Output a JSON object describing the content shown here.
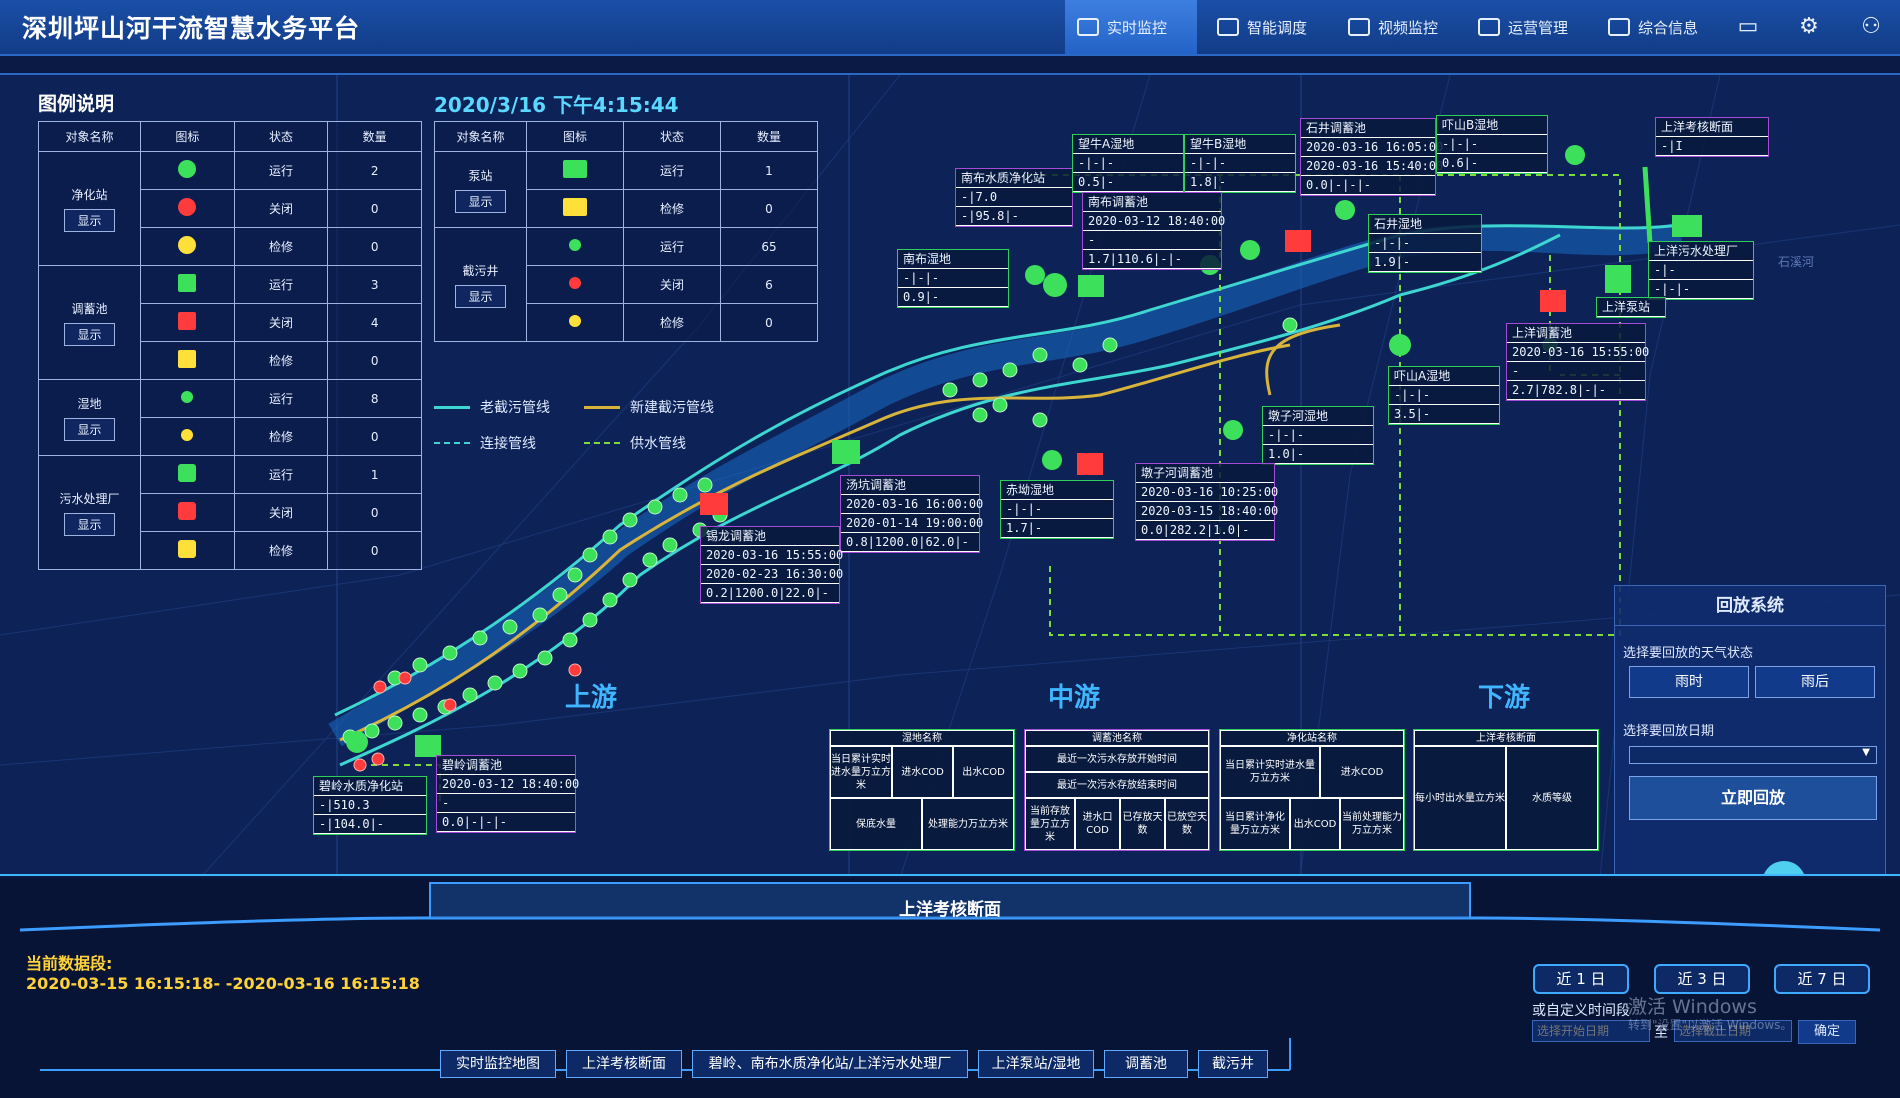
{
  "app": {
    "title": "深圳坪山河干流智慧水务平台"
  },
  "nav": [
    {
      "label": "实时监控",
      "active": true
    },
    {
      "label": "智能调度"
    },
    {
      "label": "视频监控"
    },
    {
      "label": "运营管理"
    },
    {
      "label": "综合信息"
    }
  ],
  "toolbar_icons": [
    "screen-icon",
    "settings-icon",
    "user-icon"
  ],
  "legend": {
    "title": "图例说明",
    "timestamp": "2020/3/16 下午4:15:44",
    "headers": [
      "对象名称",
      "图标",
      "状态",
      "数量"
    ],
    "show_label": "显示",
    "left": [
      {
        "name": "净化站",
        "rows": [
          {
            "status": "运行",
            "count": "2"
          },
          {
            "status": "关闭",
            "count": "0"
          },
          {
            "status": "检修",
            "count": "0"
          }
        ]
      },
      {
        "name": "调蓄池",
        "rows": [
          {
            "status": "运行",
            "count": "3"
          },
          {
            "status": "关闭",
            "count": "4"
          },
          {
            "status": "检修",
            "count": "0"
          }
        ]
      },
      {
        "name": "湿地",
        "rows": [
          {
            "status": "运行",
            "count": "8"
          },
          {
            "status": "检修",
            "count": "0"
          }
        ]
      },
      {
        "name": "污水处理厂",
        "rows": [
          {
            "status": "运行",
            "count": "1"
          },
          {
            "status": "关闭",
            "count": "0"
          },
          {
            "status": "检修",
            "count": "0"
          }
        ]
      }
    ],
    "right": [
      {
        "name": "泵站",
        "rows": [
          {
            "status": "运行",
            "count": "1"
          },
          {
            "status": "检修",
            "count": "0"
          }
        ]
      },
      {
        "name": "截污井",
        "rows": [
          {
            "status": "运行",
            "count": "65"
          },
          {
            "status": "关闭",
            "count": "6"
          },
          {
            "status": "检修",
            "count": "0"
          }
        ]
      }
    ],
    "lines": [
      {
        "label": "老截污管线",
        "color": "#3dd6d0",
        "style": "solid"
      },
      {
        "label": "新建截污管线",
        "color": "#d8b43a",
        "style": "solid"
      },
      {
        "label": "连接管线",
        "color": "#3dd6d0",
        "style": "dashed"
      },
      {
        "label": "供水管线",
        "color": "#7ddc3a",
        "style": "dashed"
      }
    ],
    "status_colors": {
      "运行": "#3ce05a",
      "关闭": "#ff3b3b",
      "检修": "#ffe03a"
    }
  },
  "map": {
    "regions": [
      "上游",
      "中游",
      "下游"
    ],
    "sites": [
      {
        "name": "南布水质净化站",
        "lines": [
          "-|7.0",
          "-|95.8|-"
        ],
        "kind": "p"
      },
      {
        "name": "望牛A湿地",
        "lines": [
          "-|-|-",
          "0.5|-"
        ],
        "kind": "g"
      },
      {
        "name": "望牛B湿地",
        "lines": [
          "-|-|-",
          "1.8|-"
        ],
        "kind": "g"
      },
      {
        "name": "石井调蓄池",
        "lines": [
          "2020-03-16 16:05:00",
          "2020-03-16 15:40:00",
          "0.0|-|-|-"
        ],
        "kind": "p"
      },
      {
        "name": "吓山B湿地",
        "lines": [
          "-|-|-",
          "0.6|-"
        ],
        "kind": "g"
      },
      {
        "name": "上洋考核断面",
        "lines": [
          "-|I"
        ],
        "kind": "p"
      },
      {
        "name": "南布调蓄池",
        "lines": [
          "2020-03-12 18:40:00",
          "-",
          "1.7|110.6|-|-"
        ],
        "kind": "p"
      },
      {
        "name": "南布湿地",
        "lines": [
          "-|-|-",
          "0.9|-"
        ],
        "kind": "g"
      },
      {
        "name": "石井湿地",
        "lines": [
          "-|-|-",
          "1.9|-"
        ],
        "kind": "g"
      },
      {
        "name": "上洋污水处理厂",
        "lines": [
          "-|-",
          "-|-|-"
        ],
        "kind": "g"
      },
      {
        "name": "上洋泵站",
        "lines": [],
        "kind": "g"
      },
      {
        "name": "上洋调蓄池",
        "lines": [
          "2020-03-16 15:55:00",
          "-",
          "2.7|782.8|-|-"
        ],
        "kind": "p"
      },
      {
        "name": "吓山A湿地",
        "lines": [
          "-|-|-",
          "3.5|-"
        ],
        "kind": "g"
      },
      {
        "name": "墩子河湿地",
        "lines": [
          "-|-|-",
          "1.0|-"
        ],
        "kind": "g"
      },
      {
        "name": "墩子河调蓄池",
        "lines": [
          "2020-03-16 10:25:00",
          "2020-03-15 18:40:00",
          "0.0|282.2|1.0|-"
        ],
        "kind": "p"
      },
      {
        "name": "汤坑调蓄池",
        "lines": [
          "2020-03-16 16:00:00",
          "2020-01-14 19:00:00",
          "0.8|1200.0|62.0|-"
        ],
        "kind": "p"
      },
      {
        "name": "赤坳湿地",
        "lines": [
          "-|-|-",
          "1.7|-"
        ],
        "kind": "g"
      },
      {
        "name": "锡龙调蓄池",
        "lines": [
          "2020-03-16 15:55:00",
          "2020-02-23 16:30:00",
          "0.2|1200.0|22.0|-"
        ],
        "kind": "p"
      },
      {
        "name": "碧岭调蓄池",
        "lines": [
          "2020-03-12 18:40:00",
          "-",
          "0.0|-|-|-"
        ],
        "kind": "p"
      },
      {
        "name": "碧岭水质净化站",
        "lines": [
          "-|510.3",
          "-|104.0|-"
        ],
        "kind": "g"
      }
    ],
    "summary_tables": {
      "wetland": {
        "title": "湿地名称",
        "cells": [
          "当日累计实时进水量万立方米",
          "进水COD",
          "出水COD",
          "保底水量",
          "处理能力万立方米"
        ]
      },
      "storage": {
        "title": "调蓄池名称",
        "cells": [
          "最近一次污水存放开始时间",
          "最近一次污水存放结束时间",
          "当前存放量万立方米",
          "进水口COD",
          "已存放天数",
          "已放空天数"
        ]
      },
      "station": {
        "title": "净化站名称",
        "cells": [
          "当日累计实时进水量万立方米",
          "进水COD",
          "当日累计净化量万立方米",
          "出水COD",
          "当前处理能力万立方米"
        ]
      },
      "section": {
        "title": "上洋考核断面",
        "cells": [
          "每小时出水量立方米",
          "水质等级"
        ]
      }
    },
    "district_labels": [
      "石溪河"
    ]
  },
  "replay": {
    "title": "回放系统",
    "weather_label": "选择要回放的天气状态",
    "weather_options": [
      "雨时",
      "雨后"
    ],
    "date_label": "选择要回放日期",
    "date_value": "",
    "submit_label": "立即回放"
  },
  "bottom": {
    "section_title": "上洋考核断面",
    "period_label": "当前数据段:",
    "period_value": "2020-03-15 16:15:18- -2020-03-16 16:15:18",
    "quick_ranges": [
      "近 1 日",
      "近 3 日",
      "近 7 日"
    ],
    "custom_label": "或自定义时间段",
    "start_placeholder": "选择开始日期",
    "to_label": "至",
    "end_placeholder": "选择截止日期",
    "confirm_label": "确定",
    "tabs": [
      "实时监控地图",
      "上洋考核断面",
      "碧岭、南布水质净化站/上洋污水处理厂",
      "上洋泵站/湿地",
      "调蓄池",
      "截污井"
    ],
    "watermark": [
      "激活 Windows",
      "转到\"设置\"以激活 Windows。"
    ]
  }
}
